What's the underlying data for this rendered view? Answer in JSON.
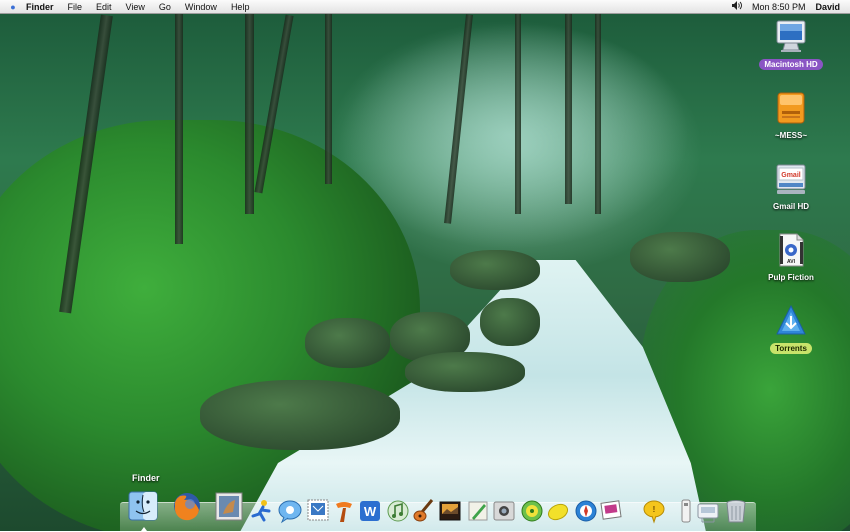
{
  "menubar": {
    "app_name": "Finder",
    "menus": [
      "File",
      "Edit",
      "View",
      "Go",
      "Window",
      "Help"
    ],
    "clock": "Mon 8:50 PM",
    "user": "David"
  },
  "desktop_icons": [
    {
      "label": "Macintosh HD",
      "icon": "hard-drive-icon"
    },
    {
      "label": "~MESS~",
      "icon": "orange-drive-icon"
    },
    {
      "label": "Gmail HD",
      "icon": "gmail-drive-icon"
    },
    {
      "label": "Pulp Fiction",
      "icon": "avi-file-icon"
    },
    {
      "label": "Torrents",
      "icon": "torrent-app-icon"
    }
  ],
  "dock": {
    "tooltip": "Finder",
    "items": [
      "finder-icon",
      "firefox-icon",
      "preview-icon",
      "ichat-runner-icon",
      "ichat-icon",
      "mail-stamp-icon",
      "tool-icon",
      "word-icon",
      "itunes-icon",
      "garageband-icon",
      "iphoto-icon",
      "pen-icon",
      "photo-icon",
      "disc-icon",
      "lemon-icon",
      "safari-icon",
      "dashboard-icon",
      "chat-bubble-icon",
      "usb-icon",
      "network-icon",
      "trash-icon"
    ]
  },
  "colors": {
    "selection_purple": "#8a55c4",
    "selection_green": "#c8e36a"
  }
}
